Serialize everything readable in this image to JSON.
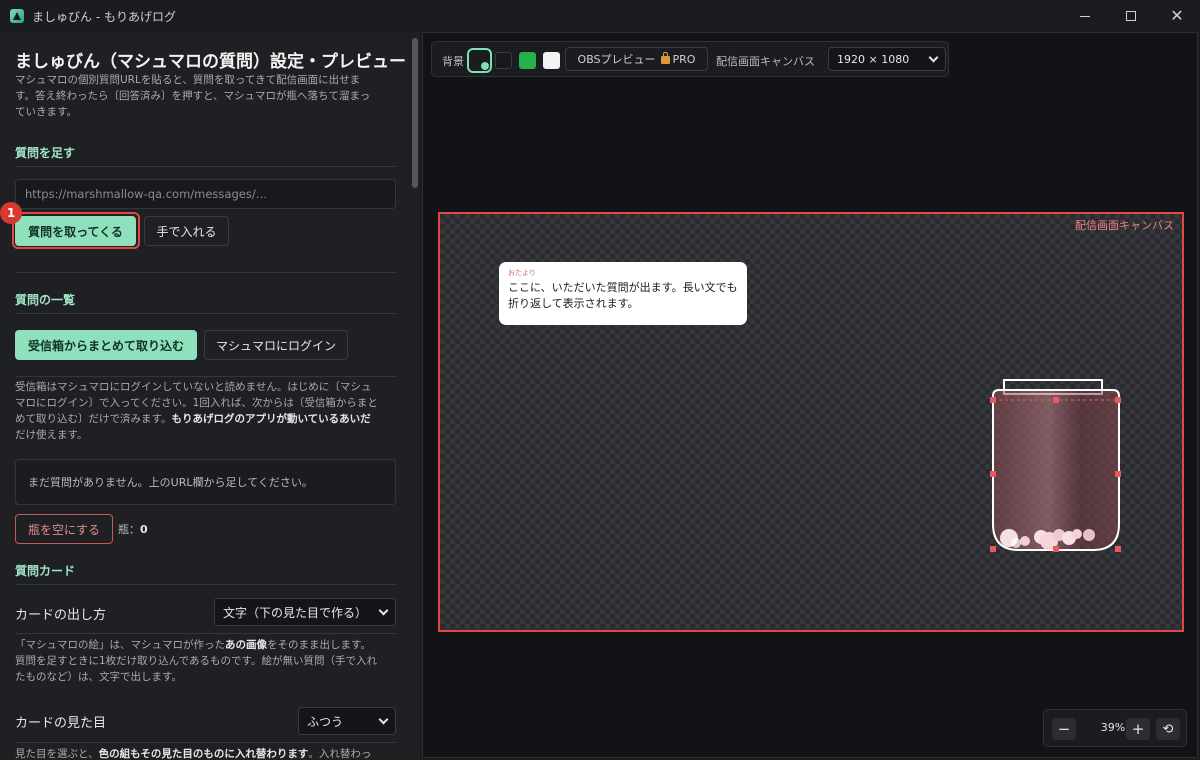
{
  "window": {
    "title": "ましゅびん - もりあげログ"
  },
  "settings": {
    "title": "ましゅびん（マシュマロの質問）設定・プレビュー",
    "description_lines": [
      "マシュマロの個別質問URLを貼ると、質問を取ってきて配信画面に出せま",
      "す。答え終わったら〔回答済み〕を押すと、マシュマロが瓶へ落ちて溜まっ",
      "ていきます。"
    ],
    "add": {
      "heading": "質問を足す",
      "url_placeholder": "https://marshmallow-qa.com/messages/…",
      "fetch_button": "質問を取ってくる",
      "manual_button": "手で入れる",
      "step_badge": "1"
    },
    "list": {
      "heading": "質問の一覧",
      "inbox_button": "受信箱からまとめて取り込む",
      "login_button": "マシュマロにログイン",
      "note_lines": [
        "受信箱はマシュマロにログインしていないと読めません。はじめに〔マシュ",
        "マロにログイン〕で入ってください。1回入れば、次からは〔受信箱からまと"
      ],
      "note_line3_plain": "めて取り込む〕だけで済みます。",
      "note_line3_bold": "もりあげログのアプリが動いているあいだ",
      "note_line4": "だけ使えます。",
      "empty_text": "まだ質問がありません。上のURL欄から足してください。",
      "empty_jar_button": "瓶を空にする",
      "jar_count_label": "瓶：",
      "jar_count": "0"
    },
    "card": {
      "heading": "質問カード",
      "output_label": "カードの出し方",
      "output_value": "文字（下の見た目で作る）",
      "help_line1_pre": "「マシュマロの絵」は、マシュマロが作った",
      "help_line1_bold": "あの画像",
      "help_line1_post": "をそのまま出します。",
      "help_line2": "質問を足すときに1枚だけ取り込んであるものです。絵が無い質問（手で入れ",
      "help_line3": "たものなど）は、文字で出します。",
      "look_label": "カードの見た目",
      "look_value": "ふつう",
      "cut_line_pre": "見た目を選ぶと、",
      "cut_line_bold": "色の組もその見た目のものに入れ替わります",
      "cut_line_post": "。入れ替わっ"
    }
  },
  "preview": {
    "toolbar": {
      "bg_label": "背景",
      "swatch_colors": [
        "#1b1c20",
        "#17181b",
        "#22b14c",
        "#f2f2f2"
      ],
      "obs_label": "OBSプレビュー",
      "pro_label": "PRO",
      "canvas_label": "配信画面キャンバス",
      "resolution": "1920 × 1080"
    },
    "canvas_tag": "配信画面キャンバス",
    "card": {
      "tag": "おたより",
      "text_line1": "ここに、いただいた質問が出ます。長い文でも",
      "text_line2": "折り返して表示されます。"
    },
    "zoom": {
      "minus": "−",
      "value": "39%",
      "plus": "+",
      "reset": "⟲"
    }
  },
  "colors": {
    "accent": "#8fe0bd",
    "danger": "#e04848",
    "section_heading": "#9fe3c4"
  }
}
